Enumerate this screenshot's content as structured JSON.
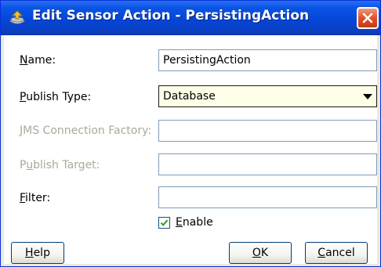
{
  "window": {
    "title": "Edit Sensor Action - PersistingAction"
  },
  "form": {
    "name": {
      "mnemonic": "N",
      "rest": "ame:",
      "value": "PersistingAction"
    },
    "publish_type": {
      "mnemonic": "P",
      "rest": "ublish Type:",
      "value": "Database"
    },
    "jms_connection_factory": {
      "mnemonic": "J",
      "rest": "MS Connection Factory:",
      "value": ""
    },
    "publish_target": {
      "pre": "P",
      "mnemonic": "u",
      "rest": "blish Target:",
      "value": ""
    },
    "filter": {
      "mnemonic": "F",
      "rest": "ilter:",
      "value": ""
    },
    "enable": {
      "mnemonic": "E",
      "rest": "nable",
      "checked": true
    }
  },
  "buttons": {
    "help": {
      "mnemonic": "H",
      "rest": "elp"
    },
    "ok": {
      "mnemonic": "O",
      "rest": "K"
    },
    "cancel": {
      "mnemonic": "C",
      "rest": "ancel"
    }
  },
  "colors": {
    "titlebar": "#0446d8",
    "close_button": "#e1502a",
    "disabled_text": "#aca899",
    "select_background": "#ffffe8"
  }
}
